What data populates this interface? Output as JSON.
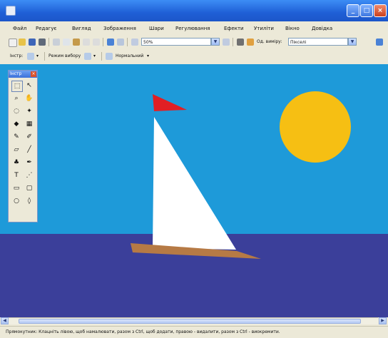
{
  "menu": {
    "items": [
      "Файл",
      "Редагує",
      "Вигляд",
      "Зображення",
      "Шари",
      "Регулювання",
      "Ефекти",
      "Утиліти",
      "Вікно",
      "Довідка"
    ]
  },
  "toolbar": {
    "zoom_value": "50%",
    "units_label": "Од. виміру:",
    "units_value": "Пікселі",
    "tool_label": "Інстр:",
    "selection_mode_label": "Режим вибору",
    "blend_value": "Нормальний"
  },
  "tools_panel": {
    "title": "Інстр",
    "close_label": "×"
  },
  "status": {
    "text": "Прямокутник: Клацніть лівою, щоб намалювати, разом з Ctrl, щоб додати, правою - видалити, разом з Ctrl - виокремити."
  },
  "colors": {
    "sky": "#1e9ad9",
    "sea": "#3b3f9a",
    "sun": "#f6bf13",
    "sail": "#ffffff",
    "flag": "#e11f24",
    "hull": "#b67a45"
  },
  "icons": {
    "title_buttons": [
      "minimize-icon",
      "maximize-icon",
      "close-icon"
    ],
    "tools": [
      "rectangle-select-icon",
      "move-icon",
      "zoom-icon",
      "pan-icon",
      "ellipse-select-icon",
      "magic-wand-icon",
      "paint-bucket-icon",
      "gradient-icon",
      "pencil-icon",
      "brush-icon",
      "eraser-icon",
      "line-icon",
      "clone-stamp-icon",
      "recolor-icon",
      "text-icon",
      "shapes-icon",
      "rectangle-icon",
      "rounded-rectangle-icon",
      "ellipse-icon",
      "freeform-icon"
    ]
  }
}
